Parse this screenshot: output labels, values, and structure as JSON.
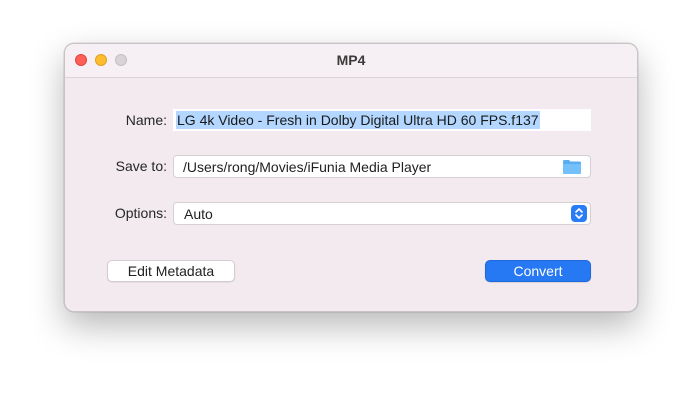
{
  "window": {
    "title": "MP4"
  },
  "form": {
    "name_label": "Name:",
    "name_value": "LG 4k Video - Fresh in Dolby Digital Ultra HD 60 FPS.f137",
    "save_label": "Save to:",
    "save_path": "/Users/rong/Movies/iFunia Media Player",
    "options_label": "Options:",
    "options_value": "Auto"
  },
  "buttons": {
    "edit_metadata": "Edit Metadata",
    "convert": "Convert"
  },
  "colors": {
    "accent": "#2678f3",
    "selection": "#b3d7ff",
    "close": "#fe5f57",
    "minimize": "#febc2e"
  }
}
